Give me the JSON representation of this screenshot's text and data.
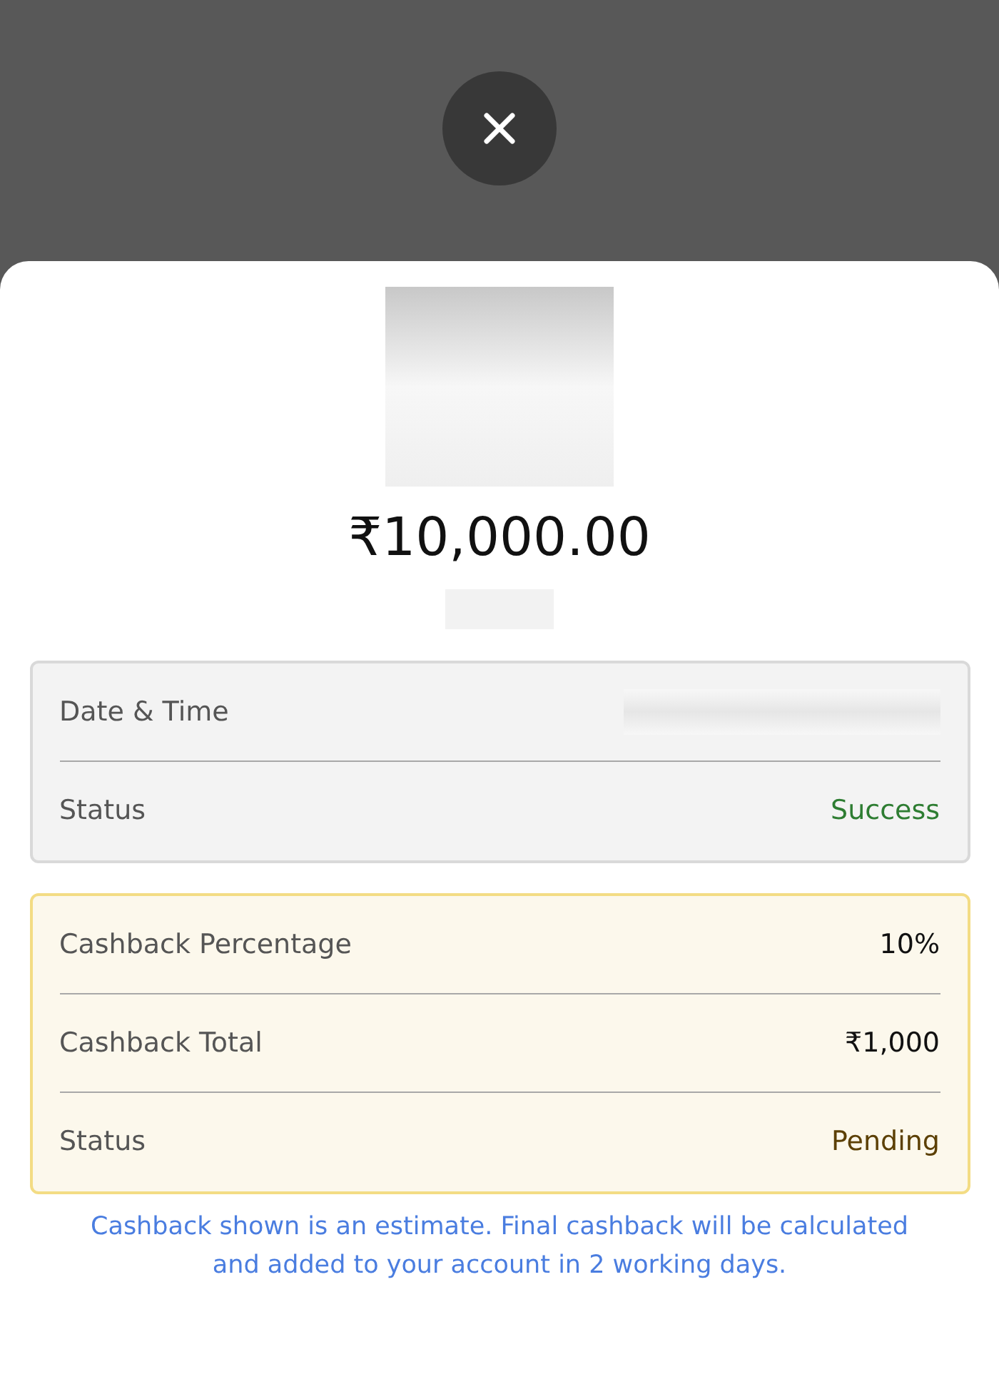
{
  "amount": "₹10,000.00",
  "details": [
    {
      "label": "Date & Time",
      "kind": "blurred"
    },
    {
      "label": "Status",
      "kind": "text",
      "value": "Success",
      "color": "#2e7d32"
    }
  ],
  "cashback": [
    {
      "label": "Cashback Percentage",
      "kind": "text",
      "value": "10%",
      "color": "#111111"
    },
    {
      "label": "Cashback Total",
      "kind": "text",
      "value": "₹1,000",
      "color": "#111111"
    },
    {
      "label": "Status",
      "kind": "text",
      "value": "Pending",
      "color": "#5c4005"
    }
  ],
  "note": "Cashback shown is an estimate. Final cashback will be calculated and added to your account in 2 working days."
}
